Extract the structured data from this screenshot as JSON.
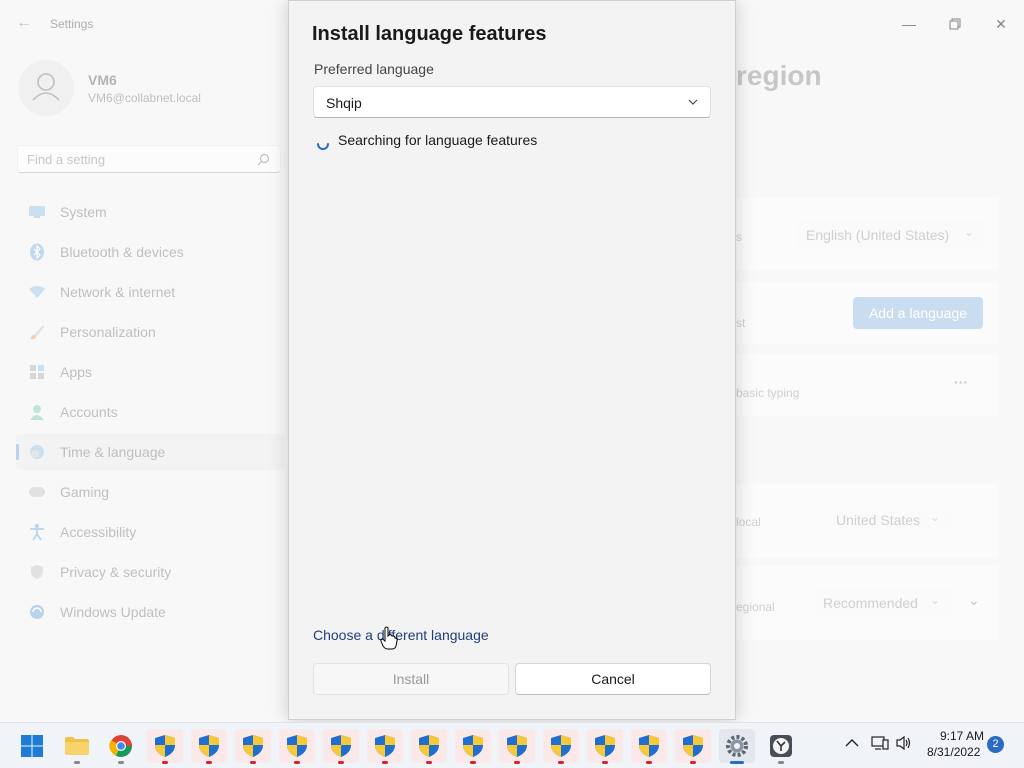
{
  "window": {
    "app_title": "Settings",
    "minimize_glyph": "—",
    "maximize_glyph": "❐",
    "close_glyph": "✕"
  },
  "user": {
    "name": "VM6",
    "email": "VM6@collabnet.local"
  },
  "search": {
    "placeholder": "Find a setting"
  },
  "sidebar": {
    "items": [
      {
        "label": "System",
        "icon": "monitor-icon"
      },
      {
        "label": "Bluetooth & devices",
        "icon": "bluetooth-icon"
      },
      {
        "label": "Network & internet",
        "icon": "wifi-icon"
      },
      {
        "label": "Personalization",
        "icon": "brush-icon"
      },
      {
        "label": "Apps",
        "icon": "apps-icon"
      },
      {
        "label": "Accounts",
        "icon": "person-icon"
      },
      {
        "label": "Time & language",
        "icon": "globe-clock-icon",
        "selected": true
      },
      {
        "label": "Gaming",
        "icon": "gamepad-icon"
      },
      {
        "label": "Accessibility",
        "icon": "accessibility-icon"
      },
      {
        "label": "Privacy & security",
        "icon": "shield-icon"
      },
      {
        "label": "Windows Update",
        "icon": "update-icon"
      }
    ]
  },
  "main": {
    "heading_fragment": "region",
    "display_language_label_fragment": "s",
    "display_language_value": "English (United States)",
    "preferred_languages_label_fragment": "st",
    "add_language_label": "Add a language",
    "typing_fragment": "basic typing",
    "more_glyph": "···",
    "country_label_fragment": "local",
    "country_value": "United States",
    "format_label_fragment": "egional",
    "format_value": "Recommended"
  },
  "dialog": {
    "title": "Install language features",
    "preferred_language_label": "Preferred language",
    "selected_language": "Shqip",
    "status_text": "Searching for language features",
    "choose_link": "Choose a different language",
    "install_label": "Install",
    "cancel_label": "Cancel"
  },
  "taskbar": {
    "apps": [
      {
        "name": "start-button",
        "icon": "windows-logo-icon"
      },
      {
        "name": "file-explorer",
        "icon": "folder-icon"
      },
      {
        "name": "chrome",
        "icon": "chrome-icon"
      },
      {
        "name": "admin-app-1",
        "icon": "uac-shield-icon"
      },
      {
        "name": "admin-app-2",
        "icon": "uac-shield-icon"
      },
      {
        "name": "admin-app-3",
        "icon": "uac-shield-icon"
      },
      {
        "name": "admin-app-4",
        "icon": "uac-shield-icon"
      },
      {
        "name": "admin-app-5",
        "icon": "uac-shield-icon"
      },
      {
        "name": "admin-app-6",
        "icon": "uac-shield-icon"
      },
      {
        "name": "admin-app-7",
        "icon": "uac-shield-icon"
      },
      {
        "name": "admin-app-8",
        "icon": "uac-shield-icon"
      },
      {
        "name": "admin-app-9",
        "icon": "uac-shield-icon"
      },
      {
        "name": "admin-app-10",
        "icon": "uac-shield-icon"
      },
      {
        "name": "admin-app-11",
        "icon": "uac-shield-icon"
      },
      {
        "name": "admin-app-12",
        "icon": "uac-shield-icon"
      },
      {
        "name": "admin-app-13",
        "icon": "uac-shield-icon"
      },
      {
        "name": "settings-app",
        "icon": "gear-icon"
      },
      {
        "name": "clock-app",
        "icon": "clock-icon"
      }
    ],
    "time": "9:17 AM",
    "date": "8/31/2022",
    "notification_count": "2"
  },
  "colors": {
    "accent": "#2a6cc4",
    "link": "#1f3f7a",
    "uac_red": "#d8232a"
  }
}
